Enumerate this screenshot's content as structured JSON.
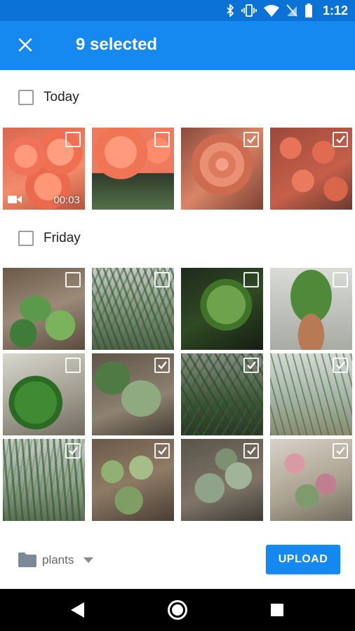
{
  "status_bar": {
    "time": "1:12",
    "icons": [
      "bluetooth-icon",
      "vibrate-icon",
      "wifi-icon",
      "no-sim-icon",
      "battery-icon"
    ]
  },
  "app_bar": {
    "title": "9 selected",
    "close_icon": "close-icon",
    "background_color": "#1689f0"
  },
  "sections": [
    {
      "label": "Today",
      "photos": [
        {
          "selected": false,
          "type": "video",
          "duration": "00:03"
        },
        {
          "selected": false,
          "type": "photo"
        },
        {
          "selected": true,
          "type": "photo"
        },
        {
          "selected": true,
          "type": "photo"
        }
      ]
    },
    {
      "label": "Friday",
      "photos": [
        {
          "selected": false,
          "type": "photo"
        },
        {
          "selected": false,
          "type": "photo"
        },
        {
          "selected": false,
          "type": "photo"
        },
        {
          "selected": false,
          "type": "photo"
        },
        {
          "selected": false,
          "type": "photo"
        },
        {
          "selected": true,
          "type": "photo"
        },
        {
          "selected": true,
          "type": "photo"
        },
        {
          "selected": true,
          "type": "photo"
        },
        {
          "selected": true,
          "type": "photo"
        },
        {
          "selected": true,
          "type": "photo"
        },
        {
          "selected": true,
          "type": "photo"
        },
        {
          "selected": true,
          "type": "photo"
        }
      ]
    }
  ],
  "bottom_bar": {
    "folder_name": "plants",
    "folder_icon": "folder-icon",
    "dropdown_icon": "dropdown-arrow-icon",
    "upload_label": "UPLOAD"
  },
  "nav_bar": {
    "icons": [
      "back-icon",
      "home-icon",
      "recents-icon"
    ]
  }
}
